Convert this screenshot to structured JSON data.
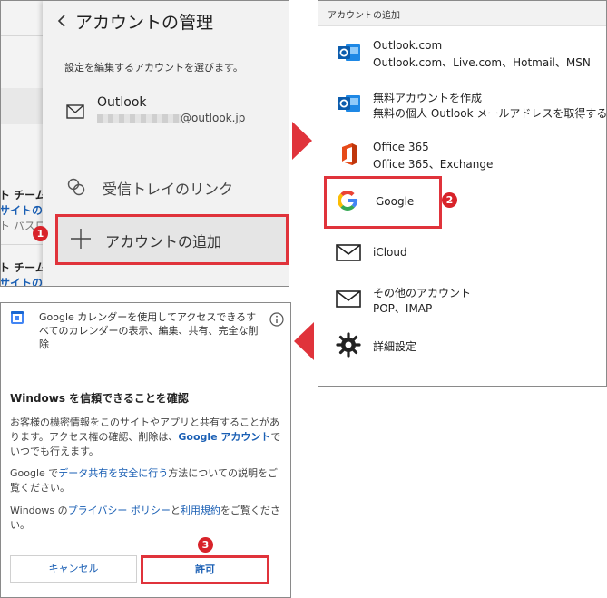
{
  "manage": {
    "title": "アカウントの管理",
    "description": "設定を編集するアカウントを選びます。",
    "account_name": "Outlook",
    "account_email": "@outlook.jp",
    "inbox_link_label": "受信トレイのリンク",
    "add_account_label": "アカウントの追加",
    "background_texts": [
      "ト チーム",
      "サイトのパス",
      "ト パスロ",
      "ト チーム",
      "サイトのパス"
    ]
  },
  "add": {
    "header": "アカウントの追加",
    "providers": [
      {
        "name": "Outlook.com",
        "sub": "Outlook.com、Live.com、Hotmail、MSN",
        "icon": "outlook-icon"
      },
      {
        "name": "無料アカウントを作成",
        "sub": "無料の個人 Outlook メールアドレスを取得する",
        "icon": "outlook-icon"
      },
      {
        "name": "Office 365",
        "sub": "Office 365、Exchange",
        "icon": "office-icon"
      },
      {
        "name": "Google",
        "sub": "",
        "icon": "google-icon"
      },
      {
        "name": "iCloud",
        "sub": "",
        "icon": "mail-icon"
      },
      {
        "name": "その他のアカウント",
        "sub": "POP、IMAP",
        "icon": "mail-icon"
      },
      {
        "name": "詳細設定",
        "sub": "",
        "icon": "gear-icon"
      }
    ]
  },
  "consent": {
    "app_description": "Google カレンダーを使用してアクセスできるすべてのカレンダーの表示、編集、共有、完全な削除",
    "heading": "Windows を信頼できることを確認",
    "p1_a": "お客様の機密情報をこのサイトやアプリと共有することがあります。アクセス権の確認、削除は、",
    "p1_link": "Google アカウント",
    "p1_b": "でいつでも行えます。",
    "p2_a": "Google で",
    "p2_link": "データ共有を安全に行う",
    "p2_b": "方法についての説明をご覧ください。",
    "p3_a": "Windows の",
    "p3_link1": "プライバシー ポリシー",
    "p3_mid": "と",
    "p3_link2": "利用規約",
    "p3_b": "をご覧ください。",
    "cancel_label": "キャンセル",
    "allow_label": "許可"
  },
  "badges": [
    "1",
    "2",
    "3"
  ],
  "colors": {
    "accent_red": "#e0333b",
    "badge_red": "#d8232a",
    "link_blue": "#1a5fb4"
  }
}
